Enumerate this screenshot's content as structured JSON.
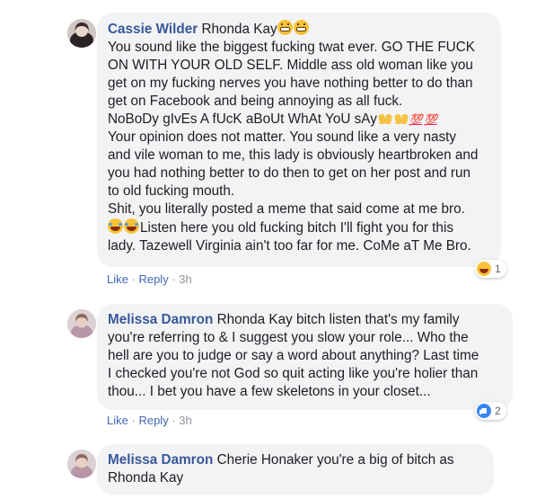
{
  "comments": [
    {
      "author": "Cassie Wilder",
      "mention": "Rhonda Kay",
      "lines": [
        "You sound like the biggest fucking twat ever. GO THE FUCK",
        "ON WITH YOUR OLD SELF. Middle ass old woman like you",
        "get on my fucking nerves you have nothing better to do than",
        "get on Facebook and being annoying as all fuck.",
        "NoBoDy gIvEs A fUcK aBoUt WhAt YoU sAy",
        "Your opinion does not matter. You sound like a very nasty",
        "and vile woman to me, this lady is obviously heartbroken and",
        "you had nothing better to do then to get on her post and run",
        "to old fucking mouth.",
        "Shit, you literally posted a meme that said come at me bro.",
        "Listen here you old fucking bitch I'll fight you for this",
        "lady. Tazewell Virginia ain't too far for me. CoMe aT Me Bro."
      ],
      "emoji_100": "💯",
      "actions": {
        "like": "Like",
        "reply": "Reply",
        "time": "3h"
      },
      "reaction": {
        "icon": "haha-reaction-icon",
        "count": "1"
      }
    },
    {
      "author": "Melissa Damron",
      "mention": "Rhonda Kay",
      "lines": [
        "bitch listen that's my family",
        "you're referring to & I suggest you slow your role... Who the",
        "hell are you to judge or say a word about anything? Last time",
        "I checked you're not God so quit acting like you're holier than",
        "thou... I bet you have a few skeletons in your closet..."
      ],
      "actions": {
        "like": "Like",
        "reply": "Reply",
        "time": "3h"
      },
      "reaction": {
        "icon": "like-reaction-icon",
        "count": "2"
      }
    },
    {
      "author": "Melissa Damron",
      "mention": "Cherie Honaker",
      "lines": [
        "you're a big of bitch as",
        "Rhonda Kay"
      ]
    }
  ],
  "separator": "·",
  "colors": {
    "author": "#385898",
    "link": "#4267b2",
    "bubble": "#f2f3f5",
    "meta": "#90949c"
  }
}
